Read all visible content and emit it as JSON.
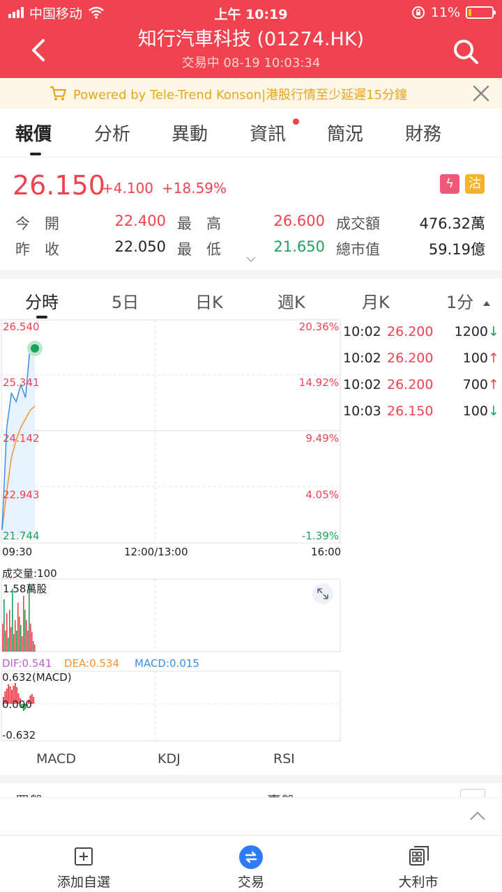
{
  "status": {
    "carrier": "中国移动",
    "time": "上午 10:19",
    "battery": "11%"
  },
  "header": {
    "title": "知行汽車科技 (01274.HK)",
    "subtitle": "交易中 08-19 10:03:34"
  },
  "notice": {
    "text": "Powered by Tele-Trend Konson|港股行情至少延遲15分鐘"
  },
  "tabs": [
    {
      "label": "報價",
      "active": true
    },
    {
      "label": "分析"
    },
    {
      "label": "異動"
    },
    {
      "label": "資訊",
      "dot": true
    },
    {
      "label": "簡況"
    },
    {
      "label": "財務"
    }
  ],
  "quote": {
    "price": "26.150",
    "change": "+4.100",
    "change_pct": "+18.59%",
    "badge1": "ϟ",
    "badge2": "沽",
    "open_label": "今　開",
    "open": "22.400",
    "high_label": "最　高",
    "high": "26.600",
    "turnover_label": "成交額",
    "turnover": "476.32萬",
    "prev_close_label": "昨　收",
    "prev_close": "22.050",
    "low_label": "最　低",
    "low": "21.650",
    "mktcap_label": "總市值",
    "mktcap": "59.19億"
  },
  "chart_tabs": [
    "分時",
    "5日",
    "日K",
    "週K",
    "月K",
    "1分"
  ],
  "chart": {
    "y_left": [
      "26.540",
      "25.341",
      "24.142",
      "22.943",
      "21.744"
    ],
    "y_right": [
      "20.36%",
      "14.92%",
      "9.49%",
      "4.05%",
      "-1.39%"
    ],
    "x_labels": [
      "09:30",
      "12:00/13:00",
      "16:00"
    ],
    "volume_label": "成交量:100",
    "volume_max": "1.58萬股",
    "dif": "DIF:0.541",
    "dea": "DEA:0.534",
    "macd": "MACD:0.015",
    "macd_top": "0.632(MACD)",
    "macd_mid": "0.000",
    "macd_bottom": "-0.632"
  },
  "trades": [
    {
      "time": "10:02",
      "price": "26.200",
      "vol": "1200",
      "dir": "↓"
    },
    {
      "time": "10:02",
      "price": "26.200",
      "vol": "100",
      "dir": "↑"
    },
    {
      "time": "10:02",
      "price": "26.200",
      "vol": "700",
      "dir": "↑"
    },
    {
      "time": "10:03",
      "price": "26.150",
      "vol": "100",
      "dir": "↓"
    }
  ],
  "indicators": [
    "MACD",
    "KDJ",
    "RSI"
  ],
  "peek": {
    "left": "買盤",
    "right": "賣盤"
  },
  "bottom_nav": [
    {
      "label": "添加自選"
    },
    {
      "label": "交易"
    },
    {
      "label": "大利市"
    }
  ],
  "colors": {
    "brand": "#f0424f",
    "up": "#f0424f",
    "down": "#1aa35b",
    "notice": "#e9a51c"
  },
  "chart_data": {
    "type": "line",
    "series": [
      {
        "name": "price",
        "x": [
          "09:30",
          "09:35",
          "09:40",
          "09:45",
          "09:50",
          "09:55",
          "10:00",
          "10:03"
        ],
        "values": [
          21.9,
          24.3,
          25.1,
          24.9,
          25.3,
          25.0,
          26.2,
          26.15
        ]
      },
      {
        "name": "avg",
        "x": [
          "09:30",
          "09:35",
          "09:40",
          "09:45",
          "09:50",
          "09:55",
          "10:00",
          "10:03"
        ],
        "values": [
          21.9,
          22.8,
          23.6,
          24.0,
          24.3,
          24.5,
          24.7,
          24.8
        ]
      }
    ],
    "ylim": [
      21.744,
      26.54
    ],
    "xlabel": "",
    "ylabel": ""
  }
}
